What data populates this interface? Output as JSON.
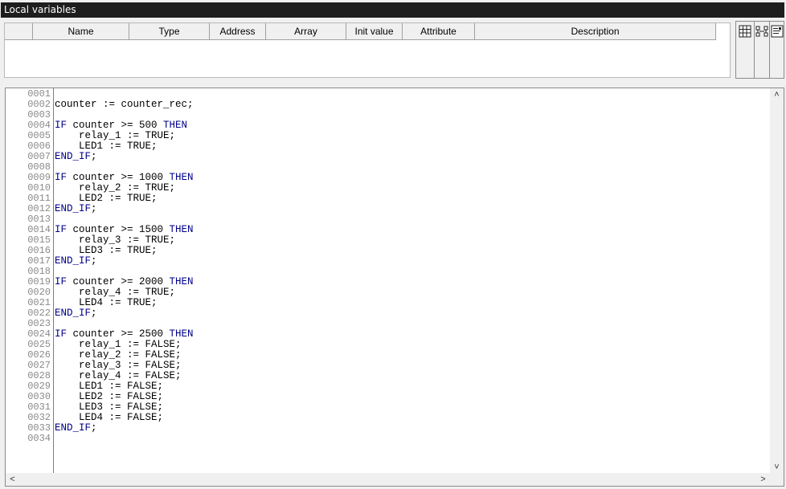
{
  "panel_title": "Local variables",
  "columns": [
    "",
    "Name",
    "Type",
    "Address",
    "Array",
    "Init value",
    "Attribute",
    "Description"
  ],
  "toolbar_icons": [
    "table-view-icon",
    "network-view-icon",
    "text-view-icon"
  ],
  "line_numbers": [
    "0001",
    "0002",
    "0003",
    "0004",
    "0005",
    "0006",
    "0007",
    "0008",
    "0009",
    "0010",
    "0011",
    "0012",
    "0013",
    "0014",
    "0015",
    "0016",
    "0017",
    "0018",
    "0019",
    "0020",
    "0021",
    "0022",
    "0023",
    "0024",
    "0025",
    "0026",
    "0027",
    "0028",
    "0029",
    "0030",
    "0031",
    "0032",
    "0033",
    "0034"
  ],
  "code": [
    {
      "t": ""
    },
    {
      "t": "counter := counter_rec;"
    },
    {
      "t": ""
    },
    {
      "kw": "IF",
      "t": " counter >= 500 ",
      "kw2": "THEN"
    },
    {
      "t": "    relay_1 := TRUE;"
    },
    {
      "t": "    LED1 := TRUE;"
    },
    {
      "kw": "END_IF",
      "t": ";"
    },
    {
      "t": ""
    },
    {
      "kw": "IF",
      "t": " counter >= 1000 ",
      "kw2": "THEN"
    },
    {
      "t": "    relay_2 := TRUE;"
    },
    {
      "t": "    LED2 := TRUE;"
    },
    {
      "kw": "END_IF",
      "t": ";"
    },
    {
      "t": ""
    },
    {
      "kw": "IF",
      "t": " counter >= 1500 ",
      "kw2": "THEN"
    },
    {
      "t": "    relay_3 := TRUE;"
    },
    {
      "t": "    LED3 := TRUE;"
    },
    {
      "kw": "END_IF",
      "t": ";"
    },
    {
      "t": ""
    },
    {
      "kw": "IF",
      "t": " counter >= 2000 ",
      "kw2": "THEN"
    },
    {
      "t": "    relay_4 := TRUE;"
    },
    {
      "t": "    LED4 := TRUE;"
    },
    {
      "kw": "END_IF",
      "t": ";"
    },
    {
      "t": ""
    },
    {
      "kw": "IF",
      "t": " counter >= 2500 ",
      "kw2": "THEN"
    },
    {
      "t": "    relay_1 := FALSE;"
    },
    {
      "t": "    relay_2 := FALSE;"
    },
    {
      "t": "    relay_3 := FALSE;"
    },
    {
      "t": "    relay_4 := FALSE;"
    },
    {
      "t": "    LED1 := FALSE;"
    },
    {
      "t": "    LED2 := FALSE;"
    },
    {
      "t": "    LED3 := FALSE;"
    },
    {
      "t": "    LED4 := FALSE;"
    },
    {
      "kw": "END_IF",
      "t": ";"
    },
    {
      "t": ""
    }
  ],
  "colors": {
    "keyword": "#00008b",
    "line_number": "#8a8a8a",
    "titlebar": "#1e1e1e"
  }
}
